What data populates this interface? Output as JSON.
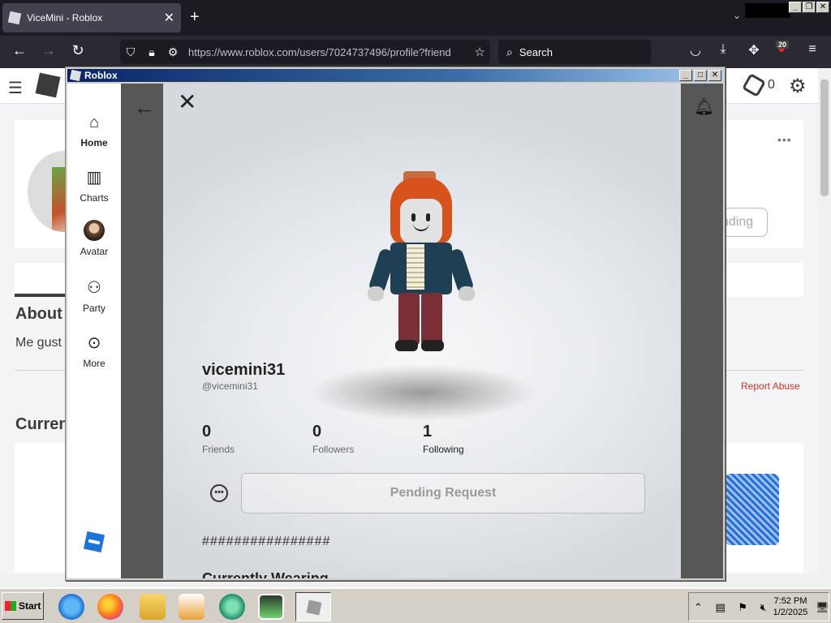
{
  "browser": {
    "tab_title": "ViceMini - Roblox",
    "tab_close": "✕",
    "new_tab": "+",
    "url": "https://www.roblox.com/users/7024737496/profile?friend",
    "search_placeholder": "Search",
    "extension_badge": "20"
  },
  "background_page": {
    "about_heading": "About",
    "about_text": "Me gust",
    "currently_heading": "Curren",
    "pending_text": "nding",
    "report_abuse": "Report Abuse",
    "robux_count": "0"
  },
  "popup": {
    "window_title": "Roblox",
    "sidenav": {
      "home": "Home",
      "charts": "Charts",
      "avatar": "Avatar",
      "party": "Party",
      "more": "More"
    },
    "profile": {
      "display_name": "vicemini31",
      "username": "@vicemini31",
      "friends_count": "0",
      "friends_label": "Friends",
      "followers_count": "0",
      "followers_label": "Followers",
      "following_count": "1",
      "following_label": "Following",
      "pending_button": "Pending Request",
      "about_text": "################",
      "currently_wearing": "Currently Wearing"
    }
  },
  "taskbar": {
    "start_label": "Start",
    "time": "7:52 PM",
    "date": "1/2/2025"
  },
  "colors": {
    "firefox_tabbar": "#1c1b22",
    "firefox_navbar": "#2b2a33",
    "report_abuse_red": "#d32f2f",
    "titlebar_blue": "#0a246a",
    "win_gray": "#d4d0c8"
  }
}
